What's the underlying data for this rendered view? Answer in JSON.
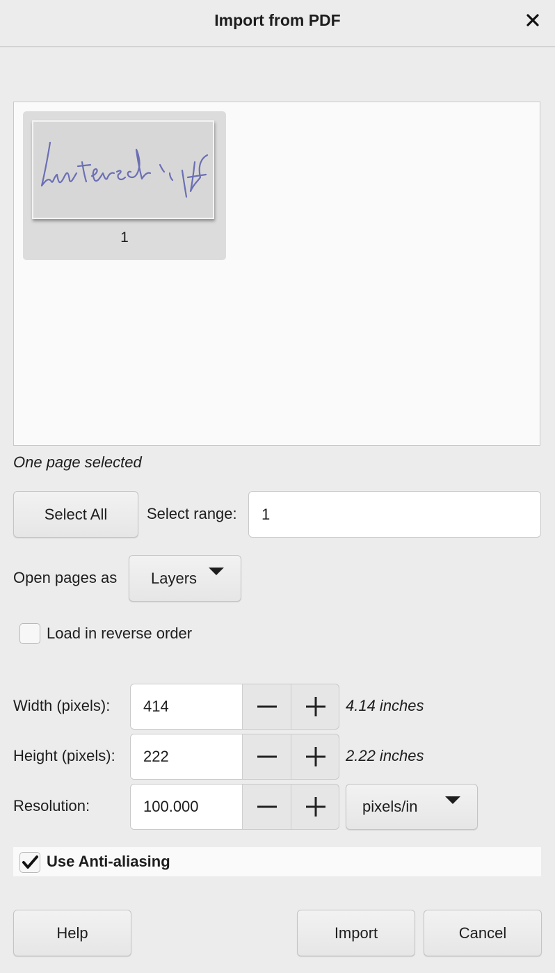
{
  "dialog": {
    "title": "Import from PDF",
    "close_icon": "close-icon"
  },
  "preview": {
    "pages": [
      {
        "label": "1",
        "signature_text": "Unterschrift"
      }
    ]
  },
  "status": "One page selected",
  "selection": {
    "select_all_label": "Select All",
    "range_label": "Select range:",
    "range_value": "1"
  },
  "open_as": {
    "label": "Open pages as",
    "value": "Layers"
  },
  "reverse": {
    "label": "Load in reverse order",
    "checked": false
  },
  "width": {
    "label": "Width (pixels):",
    "value": "414",
    "unit_text": "4.14 inches"
  },
  "height": {
    "label": "Height (pixels):",
    "value": "222",
    "unit_text": "2.22 inches"
  },
  "resolution": {
    "label": "Resolution:",
    "value": "100.000",
    "unit": "pixels/in"
  },
  "antialias": {
    "label": "Use Anti-aliasing",
    "checked": true
  },
  "buttons": {
    "help": "Help",
    "import": "Import",
    "cancel": "Cancel"
  }
}
